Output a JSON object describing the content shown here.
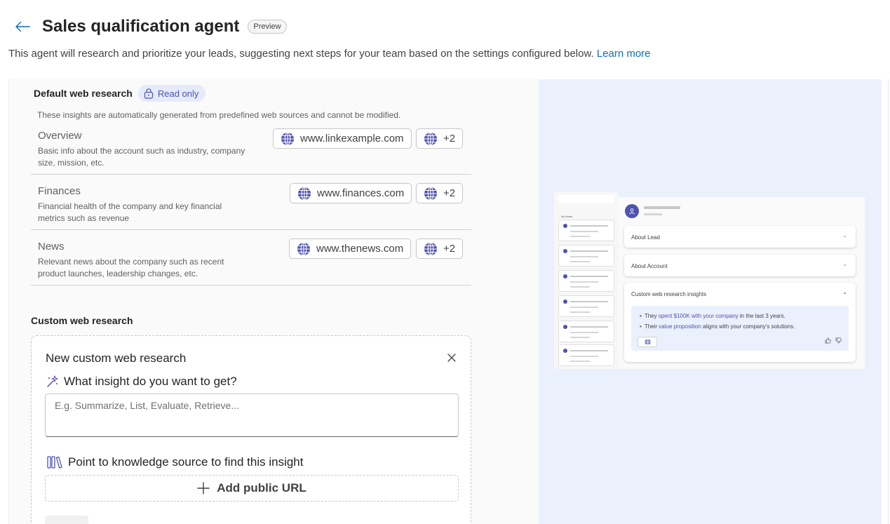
{
  "header": {
    "back_icon": "arrow-left-icon",
    "title": "Sales qualification agent",
    "badge": "Preview"
  },
  "subtitle": {
    "text": "This agent will research and prioritize your leads, suggesting next steps for your team based on the settings configured below.",
    "link": "Learn more"
  },
  "default_research": {
    "title": "Default web research",
    "badge": "Read only",
    "description": "These insights are automatically generated from predefined web sources and cannot be modified.",
    "rows": [
      {
        "name": "Overview",
        "info": "Basic info about the account such as industry, company size, mission, etc.",
        "url": "www.linkexample.com",
        "more": "+2"
      },
      {
        "name": "Finances",
        "info": "Financial health of the company and key financial metrics such as revenue",
        "url": "www.finances.com",
        "more": "+2"
      },
      {
        "name": "News",
        "info": "Relevant news about the company such as recent product launches, leadership changes, etc.",
        "url": "www.thenews.com",
        "more": "+2"
      }
    ]
  },
  "custom_research": {
    "section_title": "Custom web research",
    "card_title": "New custom web research",
    "question_label": "What insight do you want to get?",
    "input_placeholder": "E.g. Summarize, List, Evaluate, Retrieve...",
    "input_value": "",
    "source_label": "Point to knowledge source to find this insight",
    "add_url_label": "Add public URL"
  },
  "preview": {
    "sidebar_label": "My leads",
    "card_about_lead": "About Lead",
    "card_about_account": "About Account",
    "card_insights": "Custom web research insights",
    "bullet1_pre": "They ",
    "bullet1_hl": "spent $100K with your company",
    "bullet1_post": " in the last 3 years.",
    "bullet2_pre": "Their ",
    "bullet2_hl": "value proposition",
    "bullet2_post": " aligns with your company's solutions."
  },
  "colors": {
    "accent": "#4f52b2",
    "link": "#0f6cbd",
    "preview_bg": "#ebf0fd"
  }
}
